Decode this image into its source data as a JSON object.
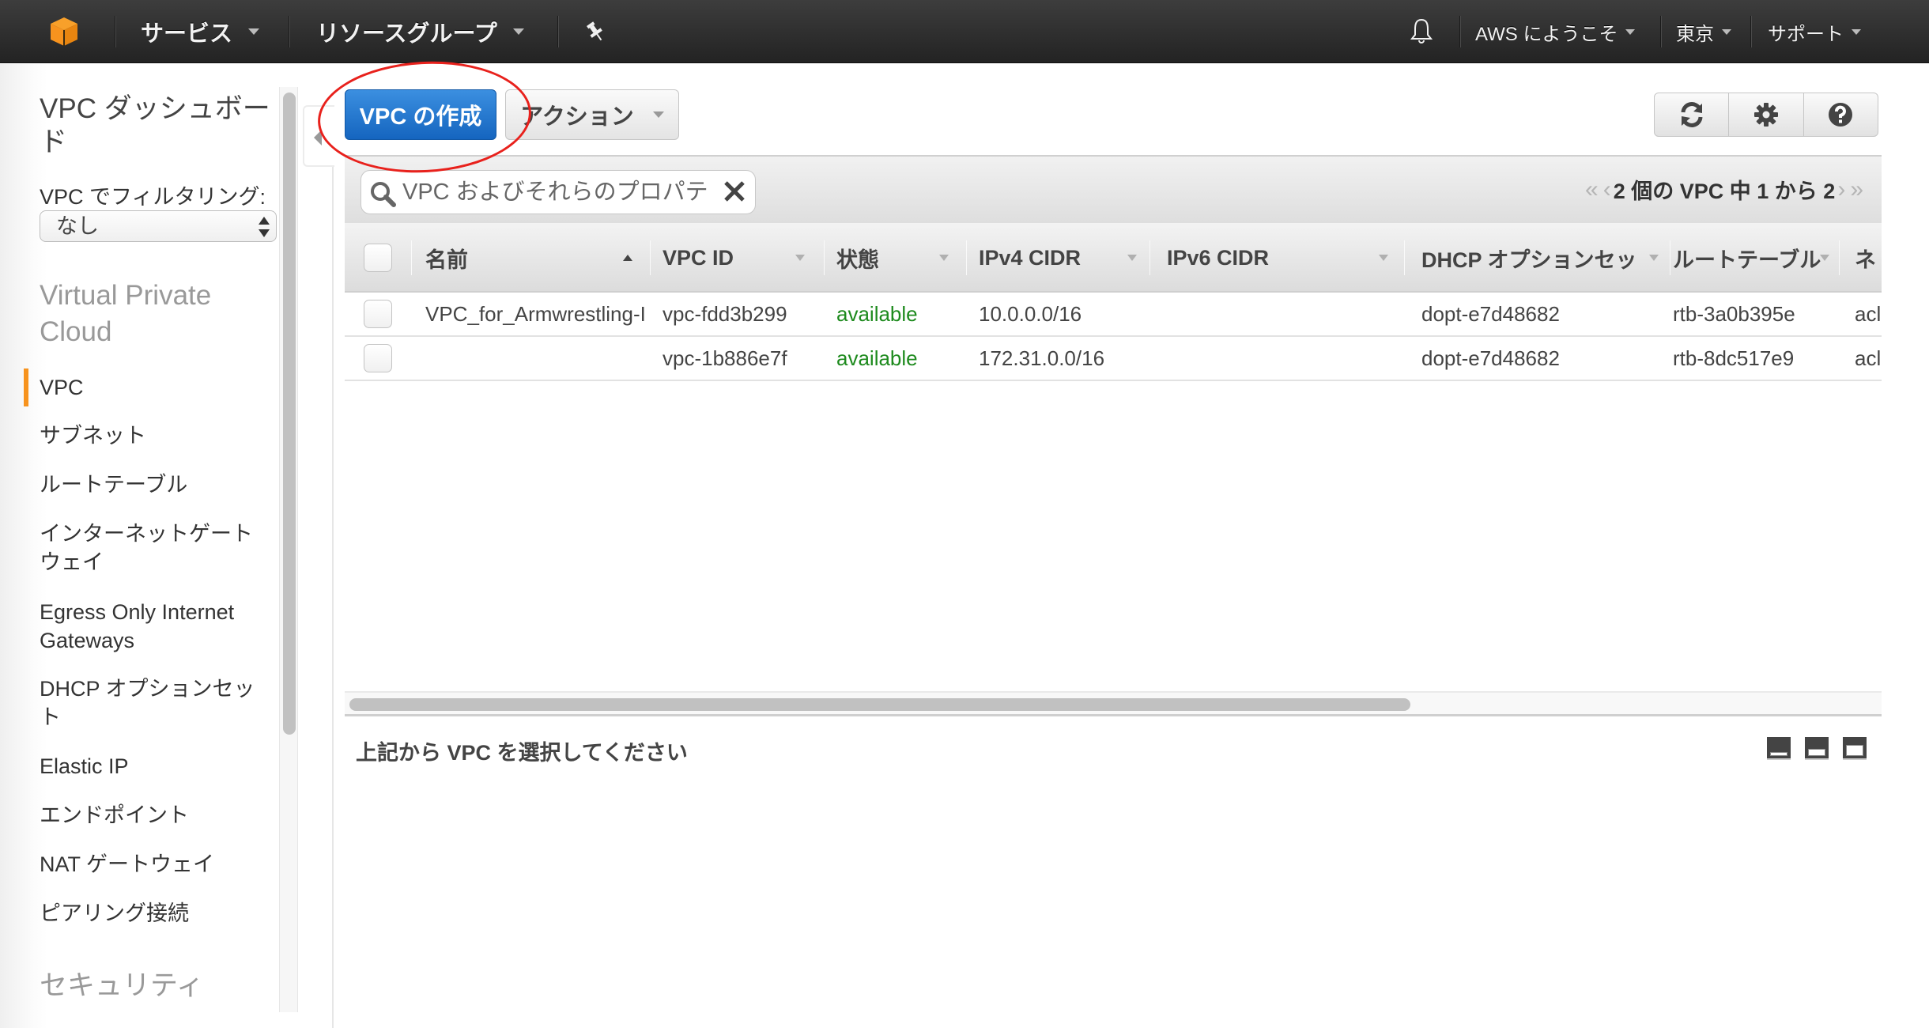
{
  "header": {
    "logo": "aws-cube-logo",
    "services_label": "サービス",
    "resource_groups_label": "リソースグループ",
    "pin_icon": "pin-icon",
    "bell_icon": "bell-icon",
    "account_label": "AWS にようこそ",
    "region_label": "東京",
    "support_label": "サポート"
  },
  "sidebar": {
    "title": "VPC ダッシュボード",
    "filter_label": "VPC でフィルタリング:",
    "filter_value": "なし",
    "sections": [
      {
        "title": "Virtual Private Cloud",
        "items": [
          {
            "label": "VPC",
            "active": true
          },
          {
            "label": "サブネット"
          },
          {
            "label": "ルートテーブル"
          },
          {
            "label": "インターネットゲートウェイ"
          },
          {
            "label": "Egress Only Internet Gateways"
          },
          {
            "label": "DHCP オプションセット"
          },
          {
            "label": "Elastic IP"
          },
          {
            "label": "エンドポイント"
          },
          {
            "label": "NAT ゲートウェイ"
          },
          {
            "label": "ピアリング接続"
          }
        ]
      },
      {
        "title": "セキュリティ",
        "items": []
      }
    ]
  },
  "toolbar": {
    "create_vpc_label": "VPC の作成",
    "actions_label": "アクション",
    "refresh_icon": "refresh-icon",
    "settings_icon": "gear-icon",
    "help_icon": "help-icon"
  },
  "filter": {
    "search_placeholder": "VPC およびそれらのプロパテ",
    "search_value": "",
    "pagination_text": "2 個の VPC 中 1 から 2",
    "first_page": "«",
    "prev_page": "‹",
    "next_page": "›",
    "last_page": "»"
  },
  "table": {
    "columns": [
      {
        "label": "名前",
        "sort": "asc"
      },
      {
        "label": "VPC ID",
        "sort": "none"
      },
      {
        "label": "状態",
        "sort": "none"
      },
      {
        "label": "IPv4 CIDR",
        "sort": "none"
      },
      {
        "label": "IPv6 CIDR",
        "sort": "none"
      },
      {
        "label": "DHCP オプションセッ",
        "sort": "none"
      },
      {
        "label": "ルートテーブル",
        "sort": "none"
      },
      {
        "label": "ネ",
        "sort": "none"
      }
    ],
    "rows": [
      {
        "name": "VPC_for_Armwrestling-I",
        "vpc_id": "vpc-fdd3b299",
        "state": "available",
        "ipv4": "10.0.0.0/16",
        "ipv6": "",
        "dhcp": "dopt-e7d48682",
        "route_table": "rtb-3a0b395e",
        "acl": "acl"
      },
      {
        "name": "",
        "vpc_id": "vpc-1b886e7f",
        "state": "available",
        "ipv4": "172.31.0.0/16",
        "ipv6": "",
        "dhcp": "dopt-e7d48682",
        "route_table": "rtb-8dc517e9",
        "acl": "acl"
      }
    ]
  },
  "detail": {
    "title": "上記から VPC を選択してください",
    "pane_layouts": [
      "pane-small-icon",
      "pane-medium-icon",
      "pane-large-icon"
    ]
  },
  "annotation": {
    "color": "#e8211c",
    "target": "create-vpc-button"
  },
  "colors": {
    "primary": "#1a6fcb",
    "active_nav": "#f7931e",
    "status_ok": "#1d8a1d",
    "header_bg": "#2e2e2e"
  }
}
